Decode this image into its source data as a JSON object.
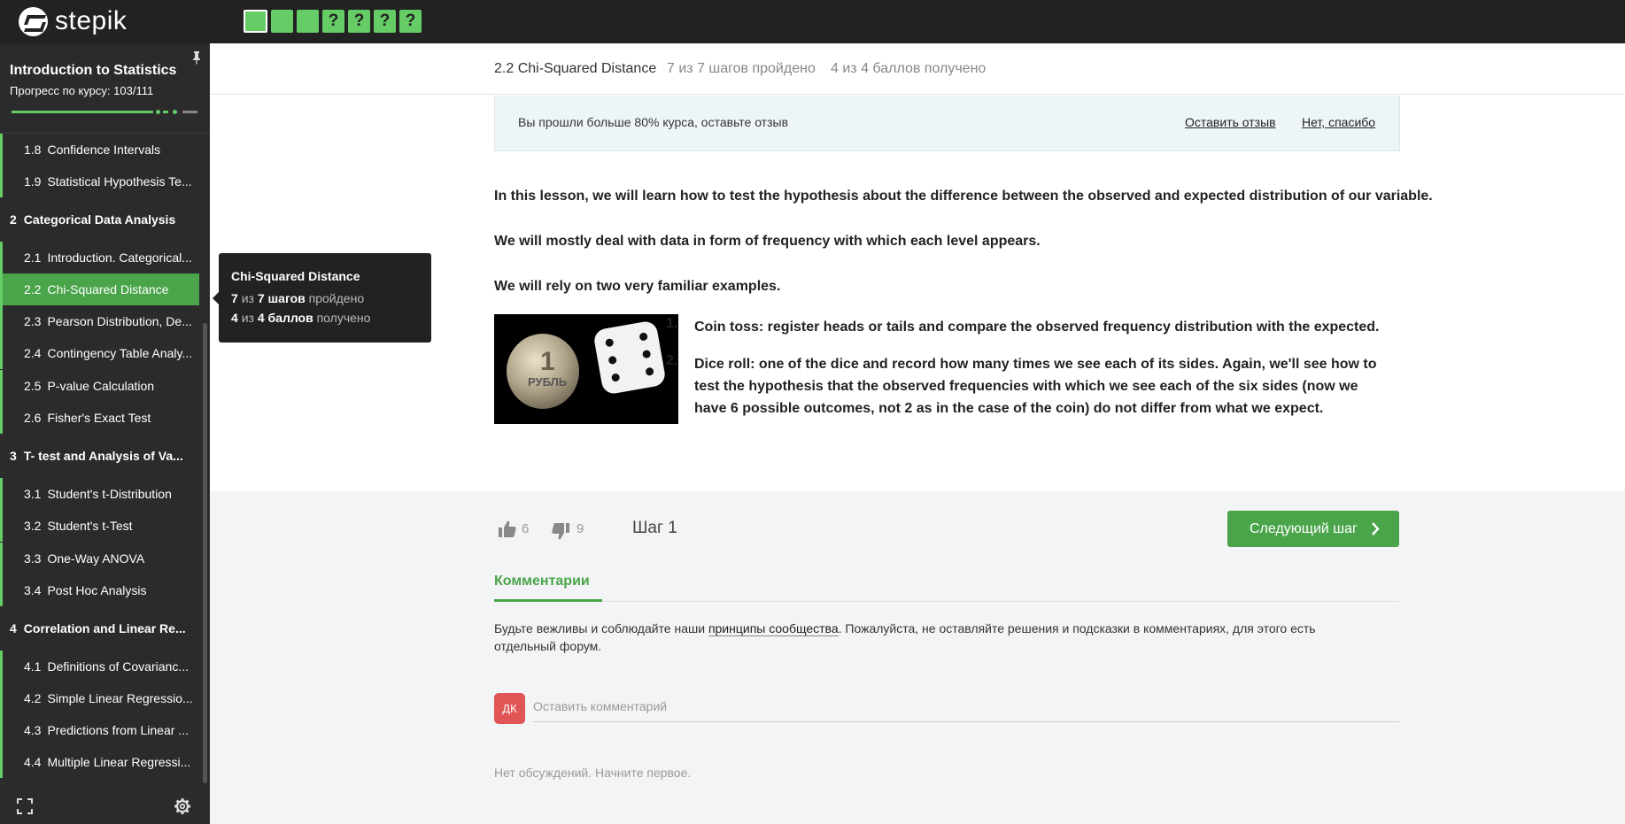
{
  "topbar": {
    "logo_text": "stepik",
    "steps": [
      {
        "label": "",
        "state": "passed",
        "current": true
      },
      {
        "label": "",
        "state": "passed",
        "current": false
      },
      {
        "label": "",
        "state": "passed",
        "current": false
      },
      {
        "label": "?",
        "state": "question",
        "current": false
      },
      {
        "label": "?",
        "state": "question",
        "current": false
      },
      {
        "label": "?",
        "state": "question",
        "current": false
      },
      {
        "label": "?",
        "state": "question",
        "current": false
      }
    ]
  },
  "sidebar": {
    "course_title": "Introduction to Statistics",
    "progress_label": "Прогресс по курсу:  103/111",
    "progress_fraction": 0.928,
    "toc": [
      {
        "type": "item",
        "num": "1.8",
        "label": "Confidence Intervals"
      },
      {
        "type": "item",
        "num": "1.9",
        "label": "Statistical Hypothesis Te..."
      },
      {
        "type": "section",
        "num": "2",
        "label": "Categorical Data Analysis"
      },
      {
        "type": "item",
        "num": "2.1",
        "label": "Introduction. Categorical..."
      },
      {
        "type": "item",
        "num": "2.2",
        "label": "Chi-Squared Distance",
        "active": true
      },
      {
        "type": "item",
        "num": "2.3",
        "label": "Pearson Distribution, De..."
      },
      {
        "type": "item",
        "num": "2.4",
        "label": "Contingency Table Analy..."
      },
      {
        "type": "item",
        "num": "2.5",
        "label": "P-value Calculation"
      },
      {
        "type": "item",
        "num": "2.6",
        "label": "Fisher's Exact Test"
      },
      {
        "type": "section",
        "num": "3",
        "label": "T- test and Analysis of Va..."
      },
      {
        "type": "item",
        "num": "3.1",
        "label": "Student's t-Distribution"
      },
      {
        "type": "item",
        "num": "3.2",
        "label": "Student's t-Test"
      },
      {
        "type": "item",
        "num": "3.3",
        "label": "One-Way ANOVA"
      },
      {
        "type": "item",
        "num": "3.4",
        "label": "Post Hoc Analysis"
      },
      {
        "type": "section",
        "num": "4",
        "label": "Correlation and Linear Re..."
      },
      {
        "type": "item",
        "num": "4.1",
        "label": "Definitions of Covarianc..."
      },
      {
        "type": "item",
        "num": "4.2",
        "label": "Simple Linear Regressio..."
      },
      {
        "type": "item",
        "num": "4.3",
        "label": "Predictions from Linear ..."
      },
      {
        "type": "item",
        "num": "4.4",
        "label": "Multiple Linear Regressi..."
      }
    ]
  },
  "tooltip": {
    "title": "Chi-Squared Distance",
    "steps_done": "7",
    "steps_of": "из",
    "steps_total": "7 шагов",
    "steps_suffix": "пройдено",
    "points_got": "4",
    "points_of": "из",
    "points_total": "4 баллов",
    "points_suffix": "получено"
  },
  "lesson_header": {
    "title": "2.2 Chi-Squared Distance",
    "steps": "7 из 7 шагов пройдено",
    "points": "4 из 4 баллов  получено"
  },
  "banner": {
    "text": "Вы прошли больше 80% курса, оставьте отзыв",
    "leave_review": "Оставить отзыв",
    "no_thanks": "Нет, спасибо"
  },
  "content": {
    "p1": "In this lesson, we will learn how to test the hypothesis about the difference between the observed and expected distribution of our variable.",
    "p2": "We will mostly deal with data in form of frequency with which each level appears.",
    "p3": "We will rely on two very familiar examples.",
    "list": [
      {
        "num": "1.",
        "text": "Coin toss: register heads or tails and compare the observed frequency distribution with the expected."
      },
      {
        "num": "2.",
        "text": "Dice roll: one of the dice and record how many times we see each of its sides. Again, we'll see how to test the hypothesis that the observed frequencies with which we see each of the six sides (now we have 6 possible outcomes, not 2 as in the case of the coin) do not differ from what we expect."
      }
    ],
    "coin_numeral": "1",
    "coin_text": "РУБЛЬ"
  },
  "footer": {
    "likes": "6",
    "dislikes": "9",
    "step_label": "Шаг 1",
    "next_button": "Следующий шаг"
  },
  "comments": {
    "tab_label": "Комментарии",
    "rules_prefix": "Будьте вежливы и соблюдайте наши ",
    "rules_link": "принципы сообщества",
    "rules_suffix": ". Пожалуйста, не оставляйте решения и подсказки в комментариях, для этого есть отдельный форум.",
    "avatar_initials": "ДК",
    "input_placeholder": "Оставить комментарий",
    "empty_text": "Нет обсуждений. Начните первое."
  },
  "colors": {
    "accent_green": "#66cc66",
    "button_green": "#4aa54a",
    "topbar_bg": "#222222",
    "sidebar_bg": "#2b2b2b",
    "avatar_red": "#e05555"
  }
}
